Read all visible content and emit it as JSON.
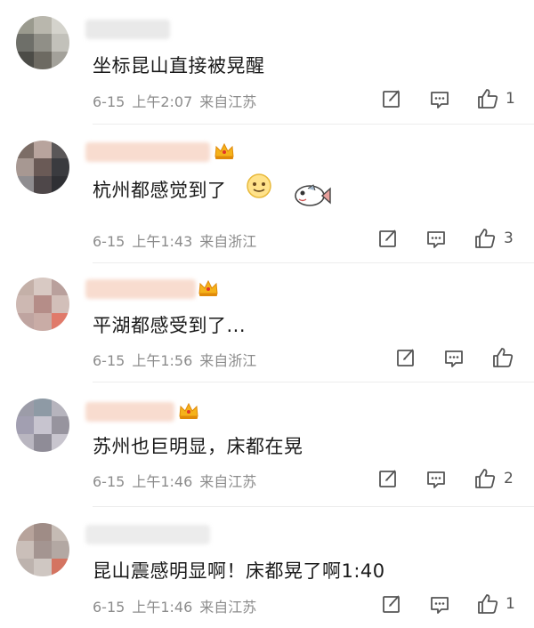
{
  "comments": [
    {
      "text": "坐标昆山直接被晃醒",
      "date": "6-15",
      "time": "上午2:07",
      "location": "来自江苏",
      "likes": "1",
      "avatar": [
        "#9a9a8e",
        "#b9b7ad",
        "#d4d3cc",
        "#6e6f69",
        "#908f87",
        "#c2c1ba",
        "#4c4c47",
        "#6d6a62",
        "#a3a19a"
      ]
    },
    {
      "text": "杭州都感觉到了",
      "date": "6-15",
      "time": "上午1:43",
      "location": "来自浙江",
      "likes": "3",
      "avatar": [
        "#7c6d66",
        "#b8a49d",
        "#5a5758",
        "#a79892",
        "#6a5a56",
        "#3a3b3f",
        "#8f8d90",
        "#4e4749",
        "#2f3034"
      ]
    },
    {
      "text": "平湖都感受到了...",
      "date": "6-15",
      "time": "上午1:56",
      "location": "来自浙江",
      "likes": "",
      "avatar": [
        "#c4b0a8",
        "#d8c9c3",
        "#b9a09c",
        "#cdb8b2",
        "#b58d88",
        "#d2bfb9",
        "#bfa4a0",
        "#c9aca6",
        "#e07a6a"
      ]
    },
    {
      "text": "苏州也巨明显，床都在晃",
      "date": "6-15",
      "time": "上午1:46",
      "location": "来自江苏",
      "likes": "2",
      "avatar": [
        "#9c9ca8",
        "#8e9aa5",
        "#b6b4bd",
        "#a29fb1",
        "#c7c4cf",
        "#97949e",
        "#b9b6c0",
        "#8f8c97",
        "#c8c5ce"
      ]
    },
    {
      "text": "昆山震感明显啊！床都晃了啊1:40",
      "date": "6-15",
      "time": "上午1:46",
      "location": "来自江苏",
      "likes": "1",
      "avatar": [
        "#b7a39b",
        "#9f8c86",
        "#c5bbb4",
        "#cabfb9",
        "#a49591",
        "#b3a8a3",
        "#bdb3ae",
        "#cfc7c2",
        "#d47461"
      ]
    }
  ],
  "icons": {
    "edit": "edit-icon",
    "comment": "comment-icon",
    "like": "thumbs-up-icon"
  },
  "colors": {
    "text": "#1a1a1a",
    "meta": "#8c8c8c",
    "crown": "#f5b21a"
  }
}
